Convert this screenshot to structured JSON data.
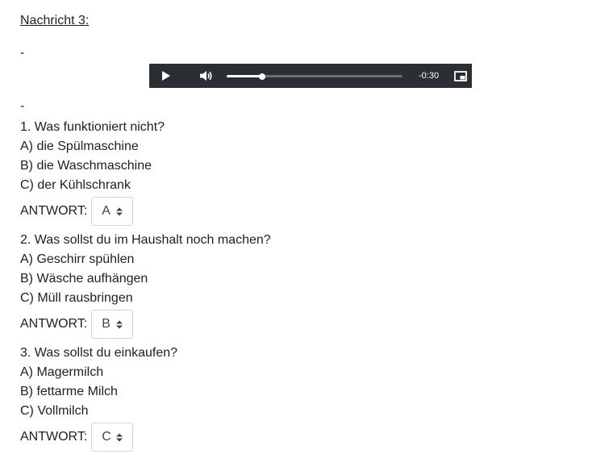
{
  "header": {
    "title": "Nachricht 3:",
    "dash_top": "-",
    "dash_bottom": "-"
  },
  "player": {
    "time": "-0:30",
    "progress_fraction": 0.2,
    "icons": [
      "play-icon",
      "volume-icon",
      "picture-in-picture-icon"
    ],
    "background_color": "#2b2f33"
  },
  "questions": [
    {
      "text": "1. Was funktioniert nicht?",
      "options": [
        "A) die Spülmaschine",
        "B) die Waschmaschine",
        "C) der Kühlschrank"
      ],
      "answer_label": "ANTWORT:",
      "answer_value": "A"
    },
    {
      "text": "2. Was sollst du im Haushalt noch machen?",
      "options": [
        "A) Geschirr spühlen",
        "B) Wäsche aufhängen",
        "C) Müll rausbringen"
      ],
      "answer_label": "ANTWORT:",
      "answer_value": "B"
    },
    {
      "text": "3. Was sollst du einkaufen?",
      "options": [
        "A) Magermilch",
        "B) fettarme Milch",
        "C) Vollmilch"
      ],
      "answer_label": "ANTWORT:",
      "answer_value": "C"
    }
  ]
}
